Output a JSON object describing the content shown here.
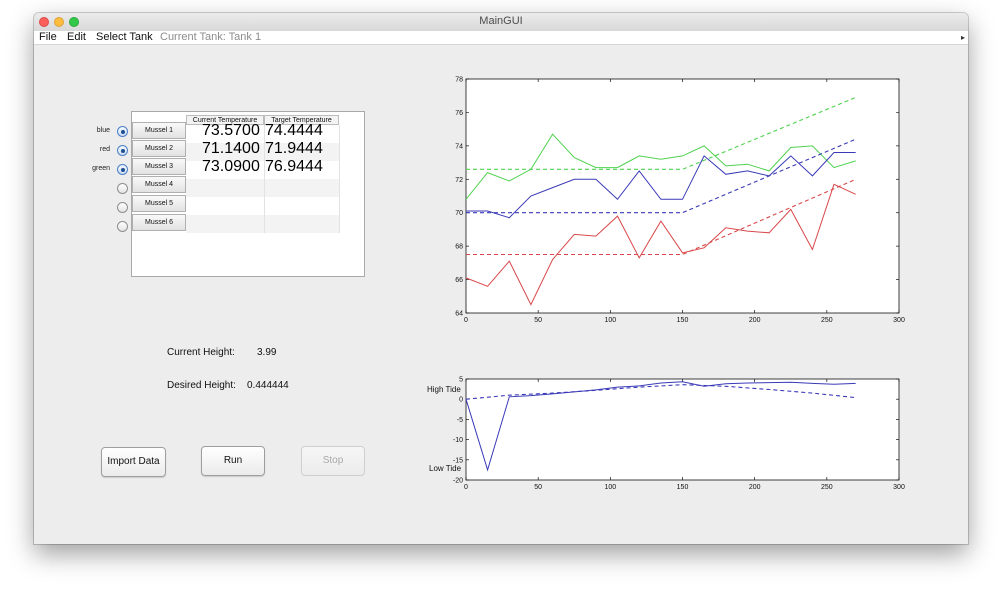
{
  "window": {
    "title": "MainGUI"
  },
  "menu": {
    "items": [
      "File",
      "Edit",
      "Select Tank"
    ],
    "current_tank": "Current Tank: Tank 1"
  },
  "radios": [
    {
      "label": "blue",
      "selected": true
    },
    {
      "label": "red",
      "selected": true
    },
    {
      "label": "green",
      "selected": true
    },
    {
      "label": "",
      "selected": false
    },
    {
      "label": "",
      "selected": false
    },
    {
      "label": "",
      "selected": false
    }
  ],
  "table": {
    "columns": [
      "Current Temperature",
      "Target Temperature"
    ],
    "rows": [
      {
        "name": "Mussel 1",
        "current": "73.5700",
        "target": "74.4444"
      },
      {
        "name": "Mussel 2",
        "current": "71.1400",
        "target": "71.9444"
      },
      {
        "name": "Mussel 3",
        "current": "73.0900",
        "target": "76.9444"
      },
      {
        "name": "Mussel 4",
        "current": "",
        "target": ""
      },
      {
        "name": "Mussel 5",
        "current": "",
        "target": ""
      },
      {
        "name": "Mussel 6",
        "current": "",
        "target": ""
      }
    ]
  },
  "status": {
    "current_height_label": "Current Height:",
    "current_height_value": "3.99",
    "desired_height_label": "Desired Height:",
    "desired_height_value": "0.444444"
  },
  "buttons": {
    "import": "Import Data",
    "run": "Run",
    "stop": "Stop"
  },
  "colors": {
    "blue": "#3a3ab8",
    "red": "#d9474a",
    "green": "#4fd24f"
  },
  "chart_data": [
    {
      "type": "line",
      "xlim": [
        0,
        300
      ],
      "ylim": [
        64,
        78
      ],
      "x_ticks": [
        0,
        50,
        100,
        150,
        200,
        250,
        300
      ],
      "y_ticks": [
        64,
        66,
        68,
        70,
        72,
        74,
        76,
        78
      ],
      "series": [
        {
          "color": "green",
          "style": "solid",
          "x": [
            0,
            15,
            30,
            45,
            60,
            75,
            90,
            105,
            120,
            135,
            150,
            165,
            180,
            195,
            210,
            225,
            240,
            255,
            270
          ],
          "y": [
            70.8,
            72.4,
            71.9,
            72.6,
            74.7,
            73.3,
            72.7,
            72.7,
            73.4,
            73.2,
            73.4,
            74.0,
            72.8,
            72.9,
            72.5,
            73.9,
            74.0,
            72.7,
            73.1
          ]
        },
        {
          "color": "blue",
          "style": "solid",
          "x": [
            0,
            15,
            30,
            45,
            60,
            75,
            90,
            105,
            120,
            135,
            150,
            165,
            180,
            195,
            210,
            225,
            240,
            255,
            270
          ],
          "y": [
            70.1,
            70.1,
            69.7,
            71.0,
            71.5,
            72.0,
            72.0,
            70.8,
            72.5,
            70.8,
            70.8,
            73.4,
            72.3,
            72.5,
            72.2,
            73.4,
            72.2,
            73.6,
            73.6
          ]
        },
        {
          "color": "red",
          "style": "solid",
          "x": [
            0,
            15,
            30,
            45,
            60,
            75,
            90,
            105,
            120,
            135,
            150,
            165,
            180,
            195,
            210,
            225,
            240,
            255,
            270
          ],
          "y": [
            66.1,
            65.6,
            67.1,
            64.5,
            67.2,
            68.7,
            68.6,
            69.8,
            67.3,
            69.5,
            67.6,
            67.9,
            69.1,
            68.9,
            68.8,
            70.2,
            67.8,
            71.7,
            71.1
          ]
        },
        {
          "color": "green",
          "style": "dashed",
          "x": [
            0,
            150,
            270
          ],
          "y": [
            72.6,
            72.6,
            76.9
          ]
        },
        {
          "color": "blue",
          "style": "dashed",
          "x": [
            0,
            150,
            270
          ],
          "y": [
            70.0,
            70.0,
            74.4
          ]
        },
        {
          "color": "red",
          "style": "dashed",
          "x": [
            0,
            150,
            270
          ],
          "y": [
            67.5,
            67.5,
            72.0
          ]
        }
      ]
    },
    {
      "type": "line",
      "xlim": [
        0,
        300
      ],
      "ylim": [
        -20,
        5
      ],
      "x_ticks": [
        0,
        50,
        100,
        150,
        200,
        250,
        300
      ],
      "y_ticks": [
        -20,
        -15,
        -10,
        -5,
        0,
        5
      ],
      "annotations": [
        "High Tide",
        "Low Tide"
      ],
      "series": [
        {
          "color": "blue",
          "style": "solid",
          "x": [
            0,
            15,
            30,
            45,
            60,
            75,
            90,
            105,
            120,
            135,
            150,
            165,
            180,
            195,
            210,
            225,
            240,
            255,
            270
          ],
          "y": [
            0,
            -17.5,
            0.6,
            0.9,
            1.3,
            1.8,
            2.3,
            3.0,
            3.3,
            4.0,
            4.3,
            3.2,
            3.8,
            4.0,
            4.1,
            4.2,
            3.9,
            3.7,
            3.9
          ]
        },
        {
          "color": "blue",
          "style": "dashed",
          "x": [
            0,
            30,
            60,
            90,
            120,
            150,
            180,
            210,
            240,
            270
          ],
          "y": [
            0,
            1.0,
            1.5,
            2.2,
            3.0,
            3.6,
            3.2,
            2.4,
            1.5,
            0.4
          ]
        }
      ]
    }
  ]
}
